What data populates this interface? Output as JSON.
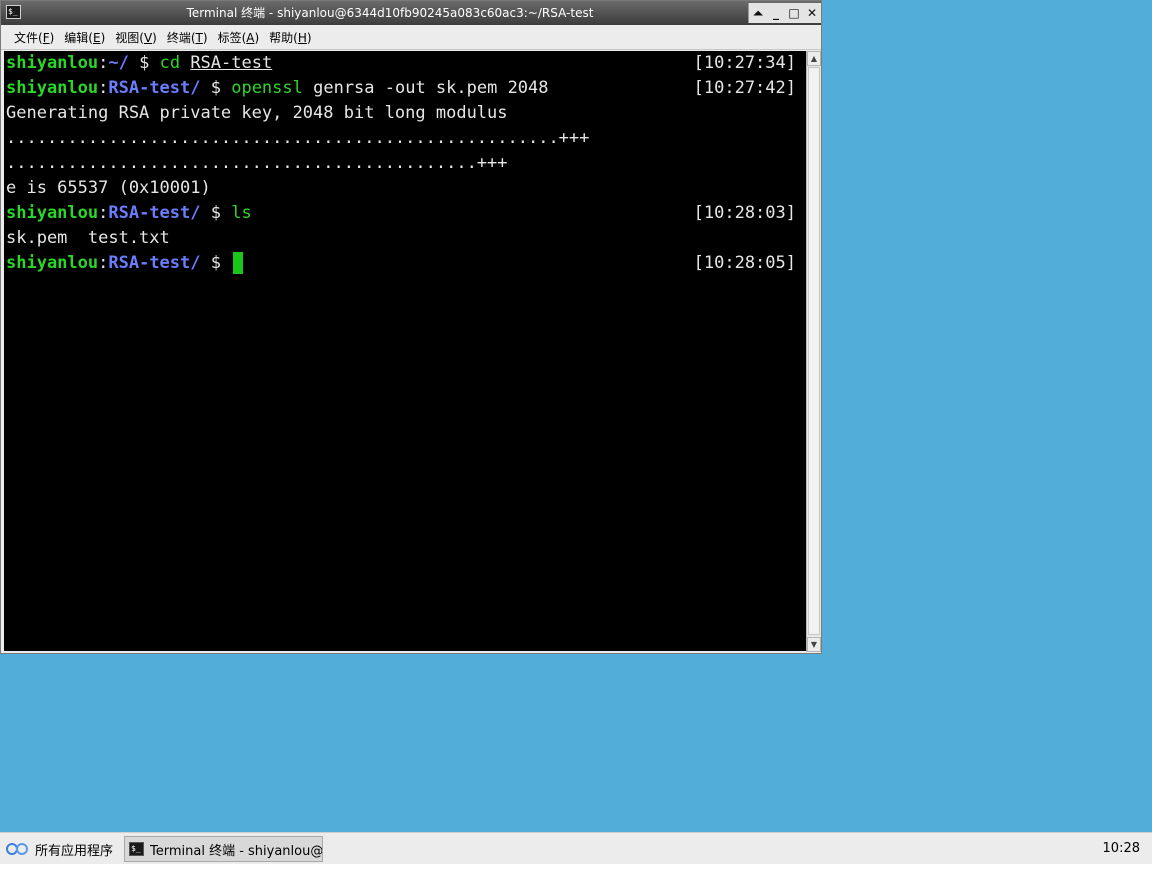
{
  "window": {
    "title": "Terminal 终端 - shiyanlou@6344d10fb90245a083c60ac3:~/RSA-test",
    "controls": {
      "shade": "⏶",
      "minimize": "_",
      "maximize": "□",
      "close": "✕"
    }
  },
  "menu": [
    {
      "label": "文件(",
      "key": "F",
      "end": ")"
    },
    {
      "label": "编辑(",
      "key": "E",
      "end": ")"
    },
    {
      "label": "视图(",
      "key": "V",
      "end": ")"
    },
    {
      "label": "终端(",
      "key": "T",
      "end": ")"
    },
    {
      "label": "标签(",
      "key": "A",
      "end": ")"
    },
    {
      "label": "帮助(",
      "key": "H",
      "end": ")"
    }
  ],
  "terminal": {
    "user": "shiyanlou",
    "colon": ":",
    "lines": {
      "l1": {
        "path": "~/",
        "prompt": " $ ",
        "cmd": "cd",
        "arg": "RSA-test",
        "time": "[10:27:34]"
      },
      "l2": {
        "path": "RSA-test/",
        "prompt": " $ ",
        "cmd": "openssl",
        "arg": " genrsa -out sk.pem 2048",
        "time": "[10:27:42]"
      },
      "l3": "Generating RSA private key, 2048 bit long modulus",
      "l4": "......................................................+++",
      "l5": "..............................................+++",
      "l6": "e is 65537 (0x10001)",
      "l7": {
        "path": "RSA-test/",
        "prompt": " $ ",
        "cmd": "ls",
        "time": "[10:28:03]"
      },
      "l8": "sk.pem  test.txt",
      "l9": {
        "path": "RSA-test/",
        "prompt": " $ ",
        "time": "[10:28:05]"
      }
    }
  },
  "taskbar": {
    "start_label": "所有应用程序",
    "task_label": "Terminal 终端 - shiyanlou@···",
    "clock": "10:28"
  },
  "colors": {
    "desktop": "#52aed8",
    "terminal_bg": "#000000",
    "user_green": "#2bd62b",
    "path_blue": "#6b7cff",
    "cursor": "#19c619"
  }
}
